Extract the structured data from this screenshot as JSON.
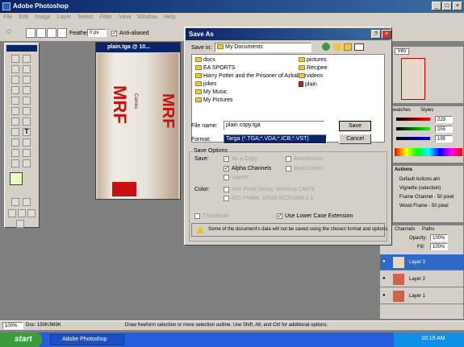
{
  "app": {
    "title": "Adobe Photoshop"
  },
  "menu": {
    "items": [
      "File",
      "Edit",
      "Image",
      "Layer",
      "Select",
      "Filter",
      "View",
      "Window",
      "Help"
    ]
  },
  "options_bar": {
    "feather_label": "Feather:",
    "feather_value": "0 px",
    "antialias_label": "Anti-aliased"
  },
  "document": {
    "title": "plain.tga @ 10...",
    "photo_text_1": "MRF",
    "photo_text_2": "Cameo",
    "photo_text_3": "MRF"
  },
  "dialog": {
    "title": "Save As",
    "save_in_label": "Save in:",
    "save_in_value": "My Documents",
    "files_left": [
      "docs",
      "EA SPORTS",
      "Harry Potter and the Prisoner of Azkaban",
      "jokes",
      "My Music",
      "My Pictures"
    ],
    "files_right": [
      "pictures",
      "Recipee",
      "videos",
      "plain"
    ],
    "file_name_label": "File name:",
    "file_name_value": "plain copy.tga",
    "format_label": "Format:",
    "format_value": "Targa (*.TGA;*.VDA;*.ICB;*.VST)",
    "save_button": "Save",
    "cancel_button": "Cancel",
    "save_options_label": "Save Options",
    "save_label": "Save:",
    "as_a_copy": "As a Copy",
    "annotations": "Annotations",
    "alpha_channels": "Alpha Channels",
    "spot_colors": "Spot Colors",
    "layers": "Layers",
    "color_label": "Color:",
    "use_proof": "Use Proof Setup: Working CMYK",
    "icc_profile": "ICC Profile: sRGB IEC61966-2.1",
    "thumbnail": "Thumbnail",
    "lowercase": "Use Lower Case Extension",
    "warning": "Some of the document's data will not be saved using the chosen format and options."
  },
  "right_panels": {
    "info_tab": "Info",
    "swatches_tab": "watches",
    "styles_tab": "Styles",
    "color_values": [
      "229",
      "255",
      "195"
    ],
    "actions_tab": "Actions",
    "actions": [
      "Default Actions.atn",
      "Vignette (selection)",
      "Frame Channel - 50 pixel",
      "Wood Frame - 50 pixel"
    ],
    "channels_tab": "Channels",
    "paths_tab": "Paths",
    "opacity_label": "Opacity:",
    "opacity_value": "100%",
    "fill_label": "Fill:",
    "fill_value": "100%",
    "layers": [
      "Layer 3",
      "Layer 2",
      "Layer 1"
    ]
  },
  "status": {
    "zoom": "100%",
    "doc": "Doc: 150K/969K",
    "hint": "Draw freeform selection or more selection outline. Use Shift, Alt, and Ctrl for additional options."
  },
  "taskbar": {
    "start": "start",
    "item": "Adobe Photoshop",
    "time": "10:19 AM"
  },
  "colors": {
    "title_blue": "#0a246a",
    "selection": "#0a246a",
    "taskbar": "#245edc",
    "start_green": "#3c9c3c",
    "layer_selected": "#3169c6"
  }
}
